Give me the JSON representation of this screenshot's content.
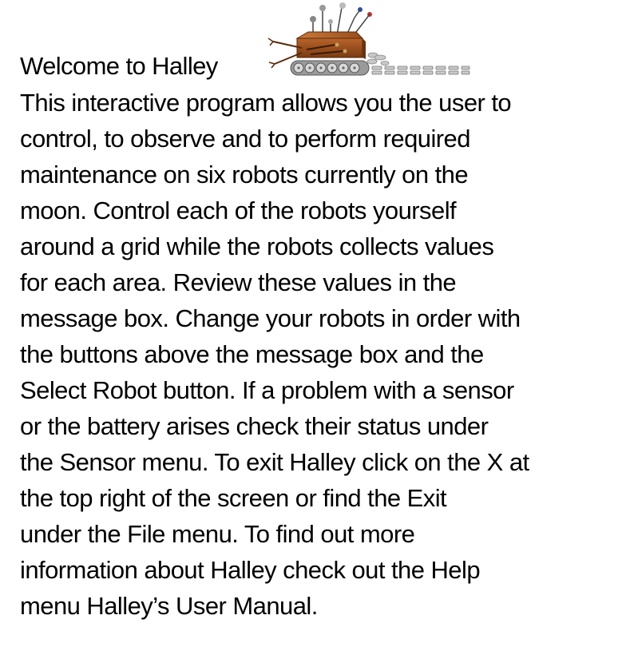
{
  "welcome": {
    "title": "Welcome to Halley",
    "robot_icon": "robot-rover-icon",
    "lines": [
      "This interactive program allows you the user to",
      "control, to observe and to perform required",
      "maintenance on six robots currently on the",
      "moon. Control each of the robots yourself",
      "around a grid while the robots collects values",
      "for each area. Review these values in the",
      "message box. Change your robots in order with",
      "the buttons above the message box and the",
      "Select Robot button. If a problem with a sensor",
      "or the battery arises check their status under",
      "the Sensor menu. To exit Halley click on the X at",
      "the top right of the screen or find the Exit",
      "under the File menu. To find out more",
      "information about Halley check out the Help",
      "menu Halley’s User Manual."
    ]
  },
  "colors": {
    "text": "#000000",
    "background": "#ffffff",
    "robot_body": "#8b4513"
  }
}
